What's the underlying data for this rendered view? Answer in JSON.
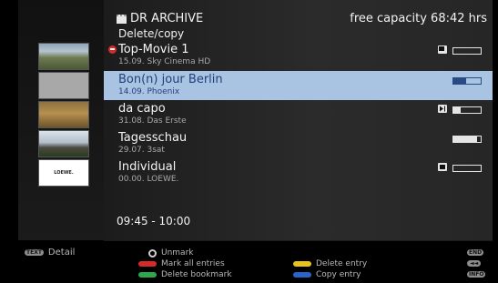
{
  "header": {
    "archive_icon": "archive-icon",
    "archive_label": "DR ARCHIVE",
    "subtitle": "Delete/copy",
    "capacity": "free capacity 68:42 hrs"
  },
  "recordings": [
    {
      "title": "Top-Movie 1",
      "meta": "15.09.  Sky Cinema HD",
      "locked": true,
      "icon": "recording-type-icon",
      "progress": 0.0
    },
    {
      "title": "Bon(n) jour Berlin",
      "meta": "14.09.  Phoenix",
      "selected": true,
      "progress": 0.45
    },
    {
      "title": "da capo",
      "meta": "31.08.  Das Erste",
      "icon": "play-icon",
      "progress": 0.25
    },
    {
      "title": "Tagesschau",
      "meta": "29.07.  3sat",
      "progress": 0.85
    },
    {
      "title": "Individual",
      "meta": "00.00.  LOEWE.",
      "icon": "square-icon",
      "progress": 0.0
    }
  ],
  "thumbnails": {
    "loewe_label": "LOEWE."
  },
  "time_range": "09:45 - 10:00",
  "footer": {
    "text_key": "TEXT",
    "detail": "Detail",
    "unmark": "Unmark",
    "mark_all": "Mark all entries",
    "delete_bookmark": "Delete bookmark",
    "delete_entry": "Delete entry",
    "copy_entry": "Copy entry",
    "end_key": "END",
    "rewind_key": "◄◄",
    "info_key": "INFO"
  },
  "colors": {
    "selection": "#a9c3e2",
    "red": "#d62a2a",
    "green": "#2ea84a",
    "yellow": "#e6c21a",
    "blue": "#2a64c8"
  }
}
